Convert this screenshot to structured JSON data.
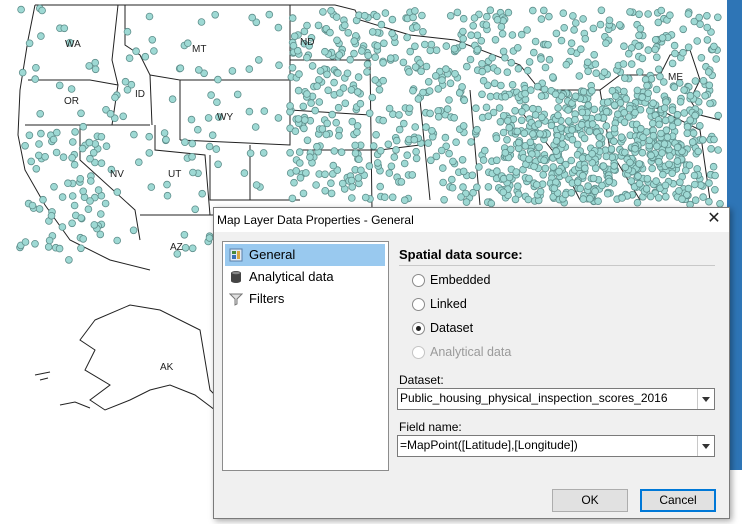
{
  "map": {
    "state_labels": [
      {
        "text": "WA"
      },
      {
        "text": "MT"
      },
      {
        "text": "ND"
      },
      {
        "text": "OR"
      },
      {
        "text": "ID"
      },
      {
        "text": "WY"
      },
      {
        "text": "NV"
      },
      {
        "text": "UT"
      },
      {
        "text": "AZ"
      },
      {
        "text": "AK"
      },
      {
        "text": "ME"
      }
    ],
    "point_color": "#9ed9d4",
    "point_stroke": "#5f8f8c"
  },
  "dialog": {
    "title": "Map Layer Data Properties - General",
    "close_glyph": "✕",
    "nav": [
      {
        "label": "General",
        "icon": "general-page-icon",
        "selected": true
      },
      {
        "label": "Analytical data",
        "icon": "database-icon",
        "selected": false
      },
      {
        "label": "Filters",
        "icon": "funnel-icon",
        "selected": false
      }
    ],
    "section_title": "Spatial data source:",
    "radios": [
      {
        "label": "Embedded",
        "checked": false,
        "disabled": false
      },
      {
        "label": "Linked",
        "checked": false,
        "disabled": false
      },
      {
        "label": "Dataset",
        "checked": true,
        "disabled": false
      },
      {
        "label": "Analytical data",
        "checked": false,
        "disabled": true
      }
    ],
    "dataset_label": "Dataset:",
    "dataset_value": "Public_housing_physical_inspection_scores_2016",
    "field_label": "Field name:",
    "field_value": "=MapPoint([Latitude],[Longitude])",
    "ok_label": "OK",
    "cancel_label": "Cancel"
  }
}
